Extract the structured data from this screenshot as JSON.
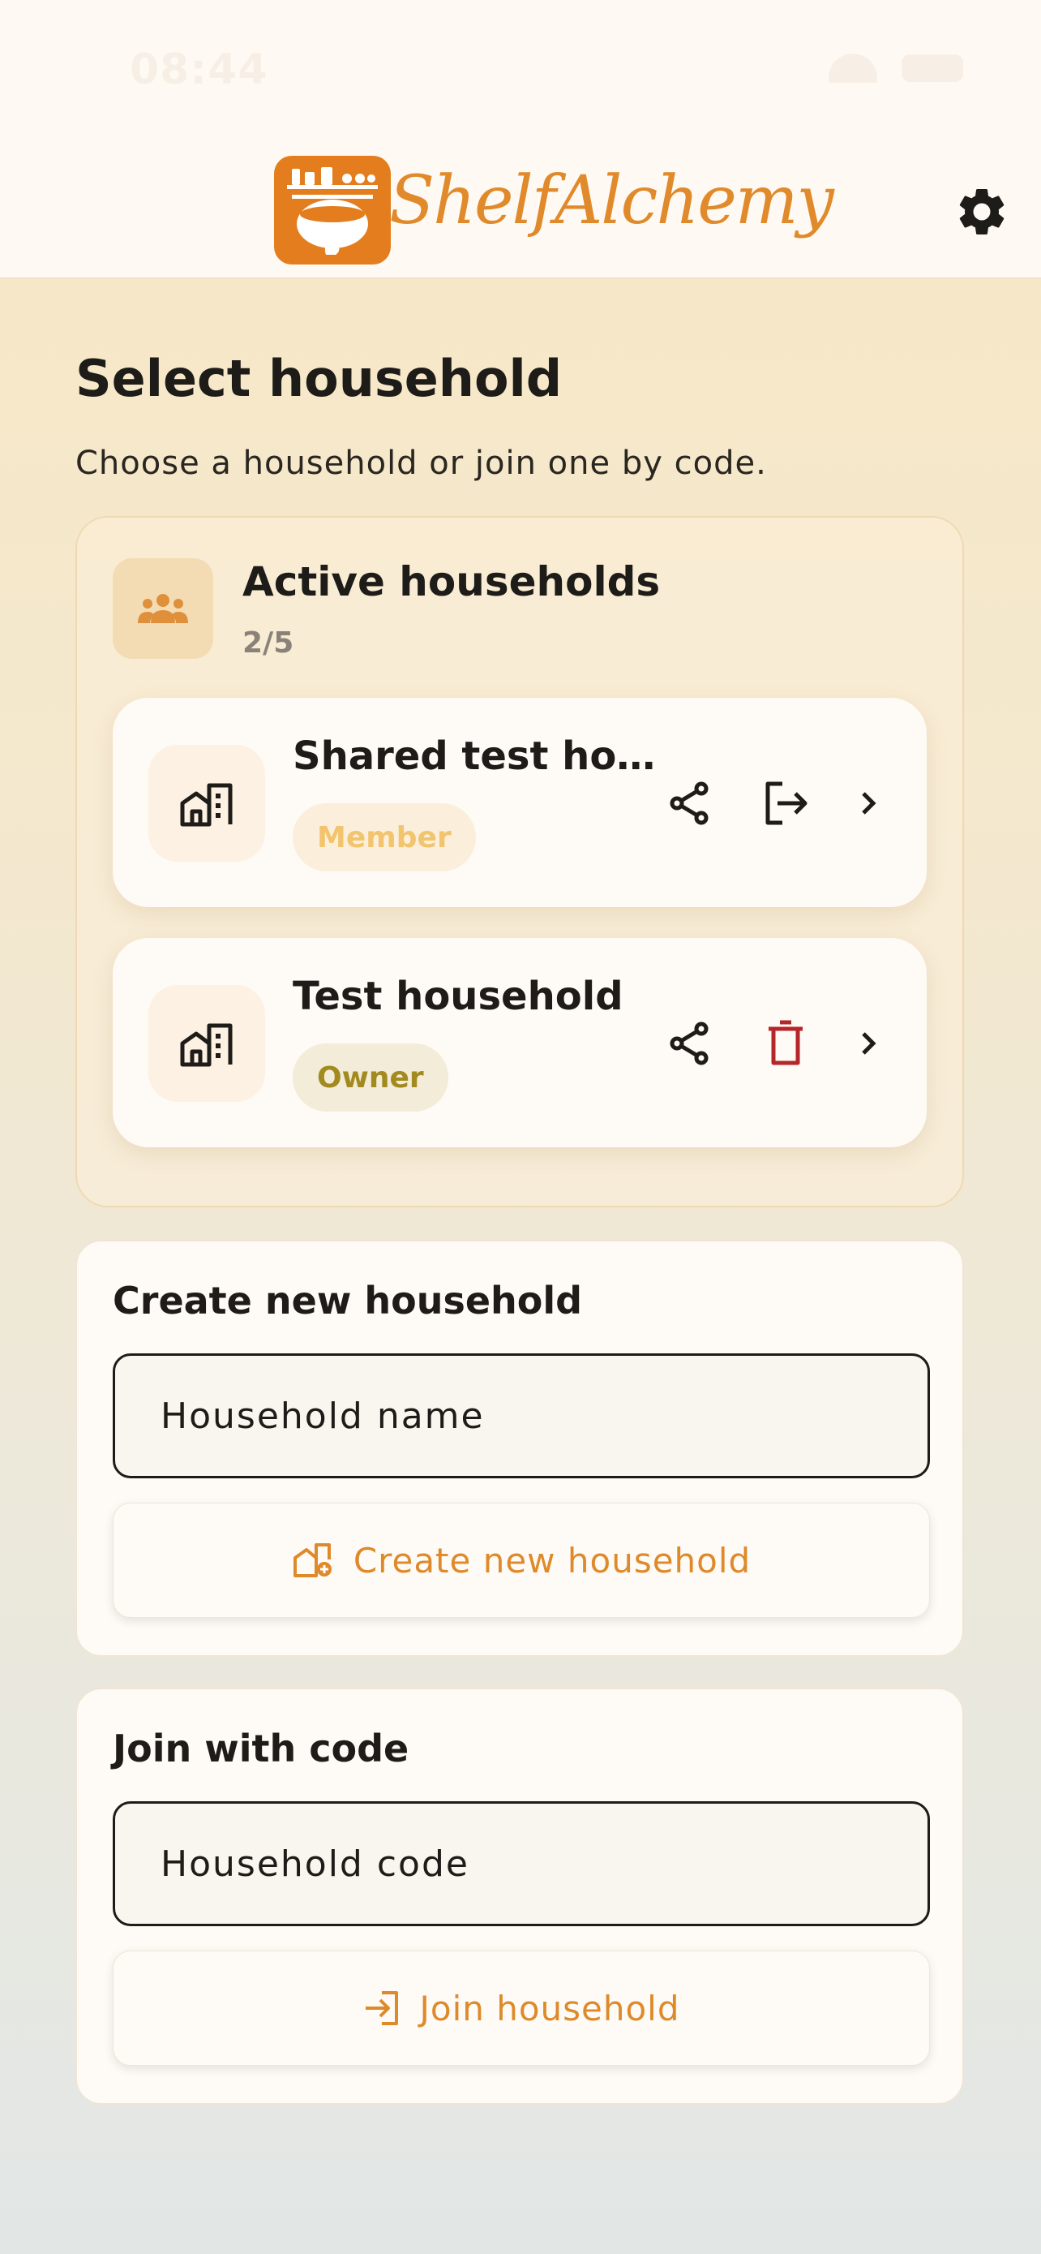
{
  "status_bar": {
    "time": "08:44",
    "wifi_icon": "wifi-icon",
    "battery_icon": "battery-icon"
  },
  "header": {
    "logo_text": "ShelfAlchemy",
    "logo_icon": "cauldron-shelf-icon",
    "settings_icon": "gear-icon"
  },
  "page": {
    "title": "Select household",
    "subtitle": "Choose a household or join one by code."
  },
  "active_households": {
    "title": "Active households",
    "count": "2/5",
    "icon": "people-group-icon",
    "items": [
      {
        "name": "Shared test ho…",
        "role": "Member",
        "role_color": "#f2c46d",
        "role_bg": "#fbefdc",
        "actions": [
          "share-icon",
          "leave-icon",
          "chevron-right-icon"
        ]
      },
      {
        "name": "Test household",
        "role": "Owner",
        "role_color": "#a28a1f",
        "role_bg": "#f2ecd8",
        "actions": [
          "share-icon",
          "trash-icon",
          "chevron-right-icon"
        ]
      }
    ]
  },
  "create": {
    "title": "Create new household",
    "placeholder": "Household name",
    "button": "Create new household",
    "button_icon": "house-add-icon"
  },
  "join": {
    "title": "Join with code",
    "placeholder": "Household code",
    "button": "Join household",
    "button_icon": "login-arrow-icon"
  },
  "colors": {
    "accent": "#de8a2a",
    "danger": "#b5262a",
    "text": "#1e1c18"
  }
}
